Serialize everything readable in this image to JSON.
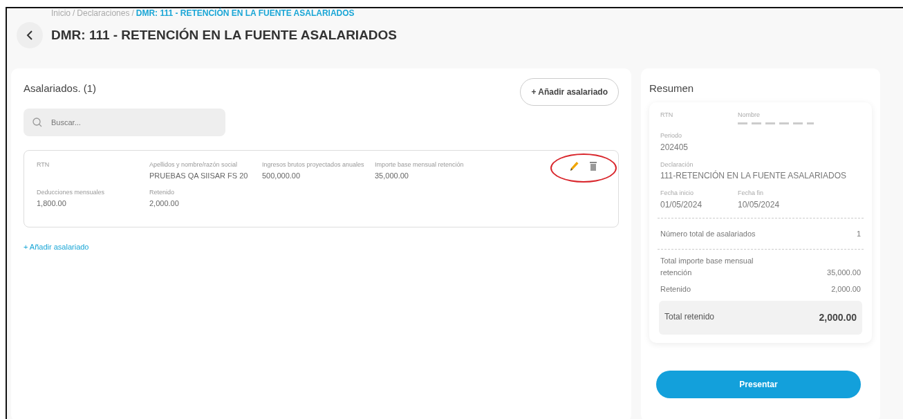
{
  "breadcrumb_separator": "/",
  "breadcrumb": [
    {
      "label": "Inicio",
      "current": false
    },
    {
      "label": "Declaraciones",
      "current": false
    },
    {
      "label": "DMR: 111 - RETENCIÓN EN LA FUENTE ASALARIADOS",
      "current": true
    }
  ],
  "page_title": "DMR: 111 - RETENCIÓN EN LA FUENTE ASALARIADOS",
  "employees": {
    "title": "Asalariados. (1)",
    "add_button": "+ Añadir asalariado",
    "search": {
      "placeholder": "Buscar..."
    },
    "records": [
      {
        "fields": [
          {
            "label": "RTN"
          },
          {
            "label": "Apellidos y nombre/razón social",
            "value": "PRUEBAS QA SIISAR FS 20"
          },
          {
            "label": "Ingresos brutos proyectados anuales",
            "value": "500,000.00"
          },
          {
            "label": "Importe base mensual retención",
            "value": "35,000.00"
          },
          {
            "label": "Deducciones mensuales",
            "value": "1,800.00"
          },
          {
            "label": "Retenido",
            "value": "2,000.00"
          }
        ]
      }
    ],
    "add_link": "+ Añadir asalariado"
  },
  "summary": {
    "title": "Resumen",
    "header_rows": [
      [
        {
          "label": "RTN"
        },
        {
          "label": "Nombre",
          "value_hidden": true
        }
      ],
      [
        {
          "label": "Periodo",
          "value": "202405"
        }
      ],
      [
        {
          "label": "Declaración",
          "value": "111-RETENCIÓN EN LA FUENTE ASALARIADOS"
        }
      ],
      [
        {
          "label": "Fecha inicio",
          "value": "01/05/2024"
        },
        {
          "label": "Fecha fin",
          "value": "10/05/2024"
        }
      ]
    ],
    "count": {
      "label": "Número total de asalariados",
      "value": "1"
    },
    "totals": [
      {
        "label": "Total importe base mensual retención",
        "value": "35,000.00"
      },
      {
        "label": "Retenido",
        "value": "2,000.00"
      }
    ],
    "grand_total": {
      "label": "Total retenido",
      "value": "2,000.00"
    },
    "submit": "Presentar"
  }
}
